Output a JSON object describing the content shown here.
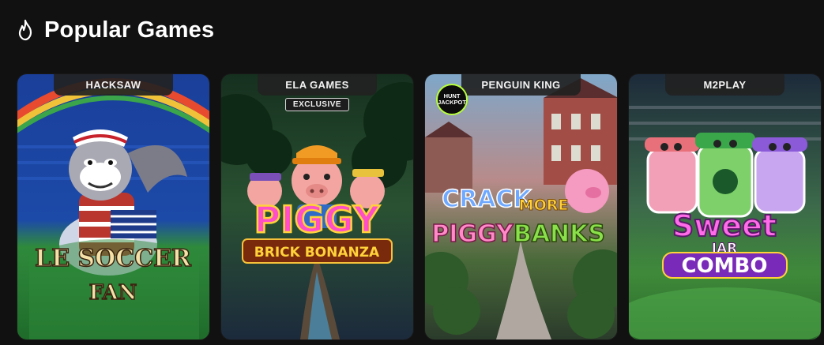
{
  "section": {
    "title": "Popular Games",
    "icon": "flame-icon"
  },
  "games": [
    {
      "provider": "HACKSAW",
      "title_lines": [
        "LE SOCCER",
        "FAN"
      ],
      "accent": "#e8c74a"
    },
    {
      "provider": "ELA GAMES",
      "badge": "EXCLUSIVE",
      "title_lines": [
        "PIGGY",
        "BRICK BONANZA"
      ],
      "accent": "#ff3fbf"
    },
    {
      "provider": "PENGUIN KING",
      "badge_lines": [
        "HUNT",
        "JACKPOT"
      ],
      "title_lines": [
        "CRACK",
        "MORE",
        "PIGGY",
        "BANKS"
      ],
      "accent": "#ff8ac8"
    },
    {
      "provider": "M2PLAY",
      "title_lines": [
        "Sweet",
        "JAR",
        "COMBO"
      ],
      "accent": "#e34fd9"
    }
  ]
}
